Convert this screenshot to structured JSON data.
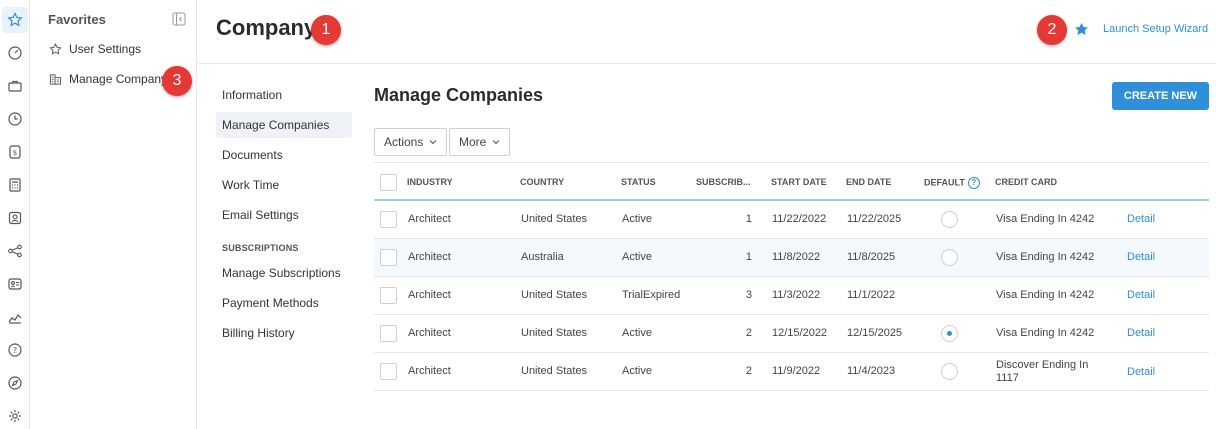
{
  "rail": {
    "icons": [
      "favorites-star-icon",
      "dashboard-icon",
      "briefcase-icon",
      "clock-dollar-icon",
      "billing-icon",
      "calculator-icon",
      "contact-icon",
      "workflow-icon",
      "id-card-icon",
      "analytics-icon",
      "help-icon",
      "compass-icon",
      "settings-gear-icon"
    ]
  },
  "favorites": {
    "title": "Favorites",
    "items": [
      {
        "label": "User Settings",
        "icon": "star-outline-icon"
      },
      {
        "label": "Manage Company",
        "icon": "building-icon"
      }
    ]
  },
  "header": {
    "title": "Company",
    "wizard_label": "Launch Setup Wizard"
  },
  "badges": [
    "1",
    "2",
    "3"
  ],
  "subnav": {
    "items": [
      "Information",
      "Manage Companies",
      "Documents",
      "Work Time",
      "Email Settings"
    ],
    "section": "SUBSCRIPTIONS",
    "sub_items": [
      "Manage Subscriptions",
      "Payment Methods",
      "Billing History"
    ]
  },
  "main": {
    "title": "Manage Companies",
    "create_label": "CREATE NEW",
    "actions_label": "Actions",
    "more_label": "More"
  },
  "table": {
    "columns": [
      "INDUSTRY",
      "COUNTRY",
      "STATUS",
      "SUBSCRIB...",
      "START DATE",
      "END DATE",
      "DEFAULT",
      "CREDIT CARD"
    ],
    "help_glyph": "?",
    "rows": [
      {
        "industry": "Architect",
        "country": "United States",
        "status": "Active",
        "subs": "1",
        "start": "11/22/2022",
        "end": "11/22/2025",
        "default": "off",
        "card": "Visa Ending In 4242",
        "action": "Detail"
      },
      {
        "industry": "Architect",
        "country": "Australia",
        "status": "Active",
        "subs": "1",
        "start": "11/8/2022",
        "end": "11/8/2025",
        "default": "off",
        "card": "Visa Ending In 4242",
        "action": "Detail"
      },
      {
        "industry": "Architect",
        "country": "United States",
        "status": "TrialExpired",
        "subs": "3",
        "start": "11/3/2022",
        "end": "11/1/2022",
        "default": "none",
        "card": "Visa Ending In 4242",
        "action": "Detail"
      },
      {
        "industry": "Architect",
        "country": "United States",
        "status": "Active",
        "subs": "2",
        "start": "12/15/2022",
        "end": "12/15/2025",
        "default": "on",
        "card": "Visa Ending In 4242",
        "action": "Detail"
      },
      {
        "industry": "Architect",
        "country": "United States",
        "status": "Active",
        "subs": "2",
        "start": "11/9/2022",
        "end": "11/4/2023",
        "default": "off",
        "card": "Discover Ending In 1117",
        "action": "Detail"
      }
    ]
  },
  "colors": {
    "accent": "#2f8fd8",
    "badge": "#e53935"
  }
}
